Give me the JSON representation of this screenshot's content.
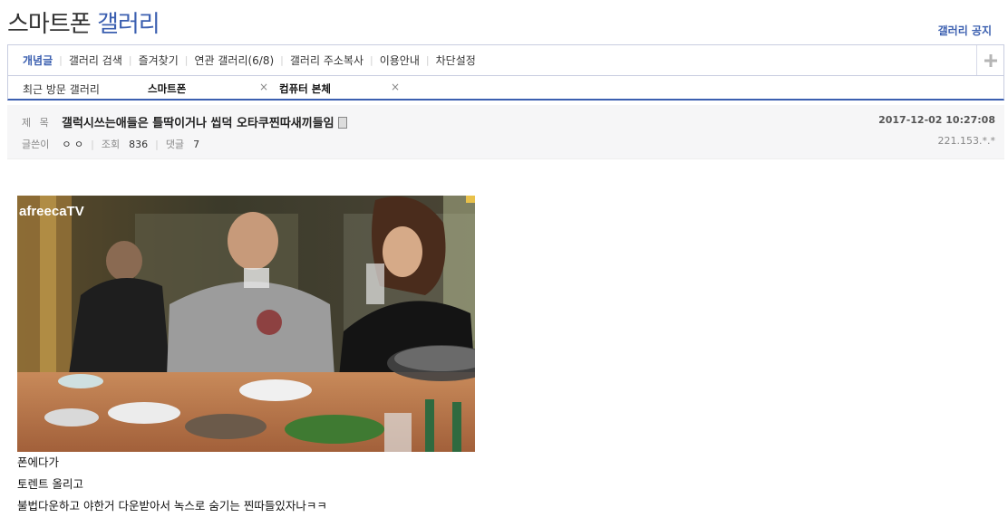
{
  "header": {
    "title_part1": "스마트폰",
    "title_part2": "갤러리",
    "notice": "갤러리 공지"
  },
  "tabs": [
    {
      "label": "개념글"
    },
    {
      "label": "갤러리 검색"
    },
    {
      "label": "즐겨찾기"
    },
    {
      "label": "연관 갤러리(6/8)"
    },
    {
      "label": "갤러리 주소복사"
    },
    {
      "label": "이용안내"
    },
    {
      "label": "차단설정"
    }
  ],
  "recent": {
    "label": "최근 방문 갤러리",
    "items": [
      "스마트폰",
      "컴퓨터 본체"
    ],
    "close_glyph": "×"
  },
  "post": {
    "subject_label": "제 목",
    "subject": "갤럭시쓰는애들은 틀딱이거나 씹덕 오타쿠찐따새끼들임",
    "date": "2017-12-02 10:27:08",
    "author_label": "글쓴이",
    "author": "ㅇ ㅇ",
    "views_label": "조회",
    "views": "836",
    "comments_label": "댓글",
    "comments": "7",
    "ip": "221.153.*.*",
    "image_watermark": "afreecaTV",
    "body": [
      "폰에다가",
      "토렌트 올리고",
      "불법다운하고 야한거 다운받아서 녹스로 숨기는 찐따들있자나ㅋㅋ"
    ]
  },
  "colors": {
    "accent": "#3b5fb0",
    "border": "#c8cde0"
  },
  "icons": {
    "add": "plus-icon",
    "close": "close-icon",
    "attachment": "document-icon"
  }
}
